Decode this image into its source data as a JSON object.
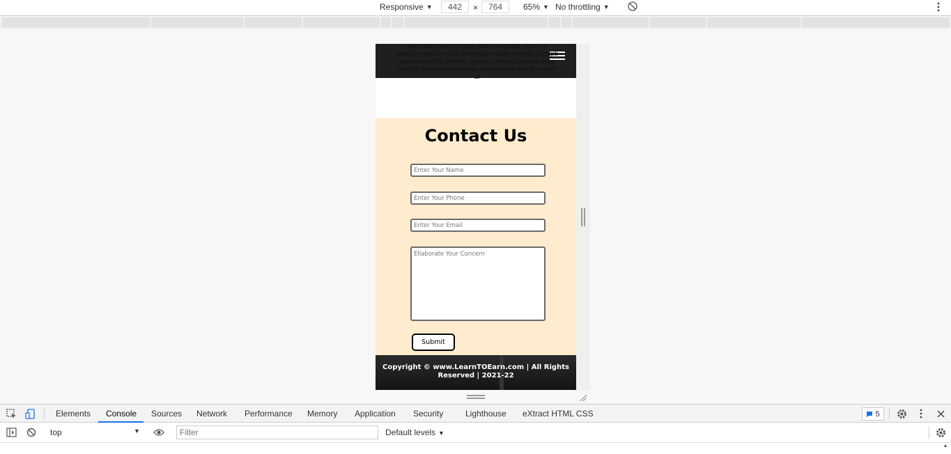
{
  "device_toolbar": {
    "device": "Responsive",
    "width": "442",
    "height": "764",
    "times": "×",
    "zoom": "65%",
    "throttling": "No throttling"
  },
  "page": {
    "overflow_text": "exercitationem cumque nobis magnam ducimus deserunt earum nulla laboriosam ullam veniam corrupti placeat mollitia deleniti. Ipsam commodi placeat vitae suscipit deleniti atque ullam doloremque iste illum eum ar",
    "contact_title": "Contact Us",
    "name_placeholder": "Enter Your Name",
    "phone_placeholder": "Enter Your Phone",
    "email_placeholder": "Enter Your Email",
    "concern_placeholder": "Ellaborate Your Concern",
    "submit_label": "Submit",
    "footer_text": "Copyright © www.LearnTOEarn.com | All Rights Reserved | 2021-22",
    "nav_bg_color": "#1f1f1f",
    "contact_bg_color": "#ffebcd"
  },
  "devtools": {
    "tabs": [
      "Elements",
      "Console",
      "Sources",
      "Network",
      "Performance",
      "Memory",
      "Application",
      "Security",
      "Lighthouse",
      "eXtract HTML CSS"
    ],
    "active_tab": "Console",
    "issues_count": "5",
    "context": "top",
    "filter_placeholder": "Filter",
    "levels": "Default levels",
    "accent_color": "#1a73e8"
  }
}
